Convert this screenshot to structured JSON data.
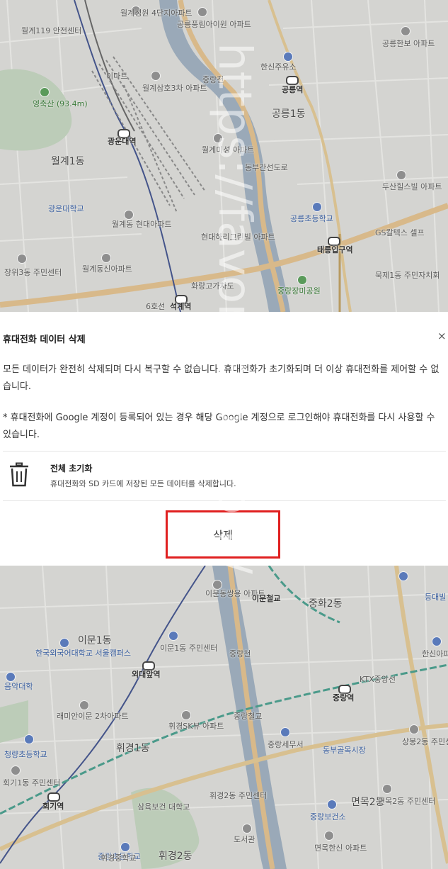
{
  "dialog": {
    "title": "휴대전화 데이터 삭제",
    "close_label": "×",
    "paragraph1": "모든 데이터가 완전히 삭제되며 다시 복구할 수 없습니다. 휴대전화가 초기화되며 더 이상 휴대전화를 제어할 수 없습니다.",
    "paragraph2": "* 휴대전화에 Google 계정이 등록되어 있는 경우 해당 Google 계정으로 로그인해야 휴대전화를 다시 사용할 수 있습니다.",
    "option": {
      "icon": "trash-icon",
      "title": "전체 초기화",
      "description": "휴대전화와 SD 카드에 저장된 모든 데이터를 삭제합니다."
    },
    "delete_label": "삭제",
    "highlight_color": "#e02020"
  },
  "watermark": "https://favorite.ps.com/",
  "map_top": {
    "labels": [
      "월계성원 4단지아파트",
      "공릉풍림아이원 아파트",
      "월계119 안전센터",
      "이마트",
      "영축산 (93.4m)",
      "월계삼호3차 아파트",
      "중랑천",
      "한신주유소",
      "공릉역",
      "공릉1동",
      "광운대역",
      "월계1동",
      "월계미성 아파트",
      "동부간선도로",
      "광운대학교",
      "월계동 현대아파트",
      "현대하리그린빌 아파트",
      "공릉초등학교",
      "태릉입구역",
      "GS칼텍스 셀프",
      "장위3동 주민센터",
      "월계동신아파트",
      "묵제1동 주민자치회",
      "화랑고가차도",
      "중랑장미공원",
      "석계역",
      "6호선",
      "공릉한보 아파트",
      "두산힐스빌 아파트"
    ]
  },
  "map_bottom": {
    "labels": [
      "이문동쌍용 아파트",
      "이문철교",
      "중화2동",
      "이문1동",
      "한국외국어대학교 서울캠퍼스",
      "이문1동 주민센터",
      "외대앞역",
      "중랑천",
      "음악대학",
      "래미안이문 2차아파트",
      "휘경SK뷰 아파트",
      "중랑철교",
      "중랑역",
      "KTX중앙선",
      "중랑세무서",
      "동부골목시장",
      "상봉2동 주민센터",
      "청량초등학교",
      "휘경1동",
      "회기1동 주민센터",
      "회기역",
      "휘경2동 주민센터",
      "면목2동",
      "면목2동 주민센터",
      "중랑보건소",
      "삼육보건 대학교",
      "중랑초등학교",
      "휘경중학교",
      "휘경2동",
      "도서관",
      "면목한신 아파트",
      "한신아파트",
      "등대빌"
    ]
  }
}
